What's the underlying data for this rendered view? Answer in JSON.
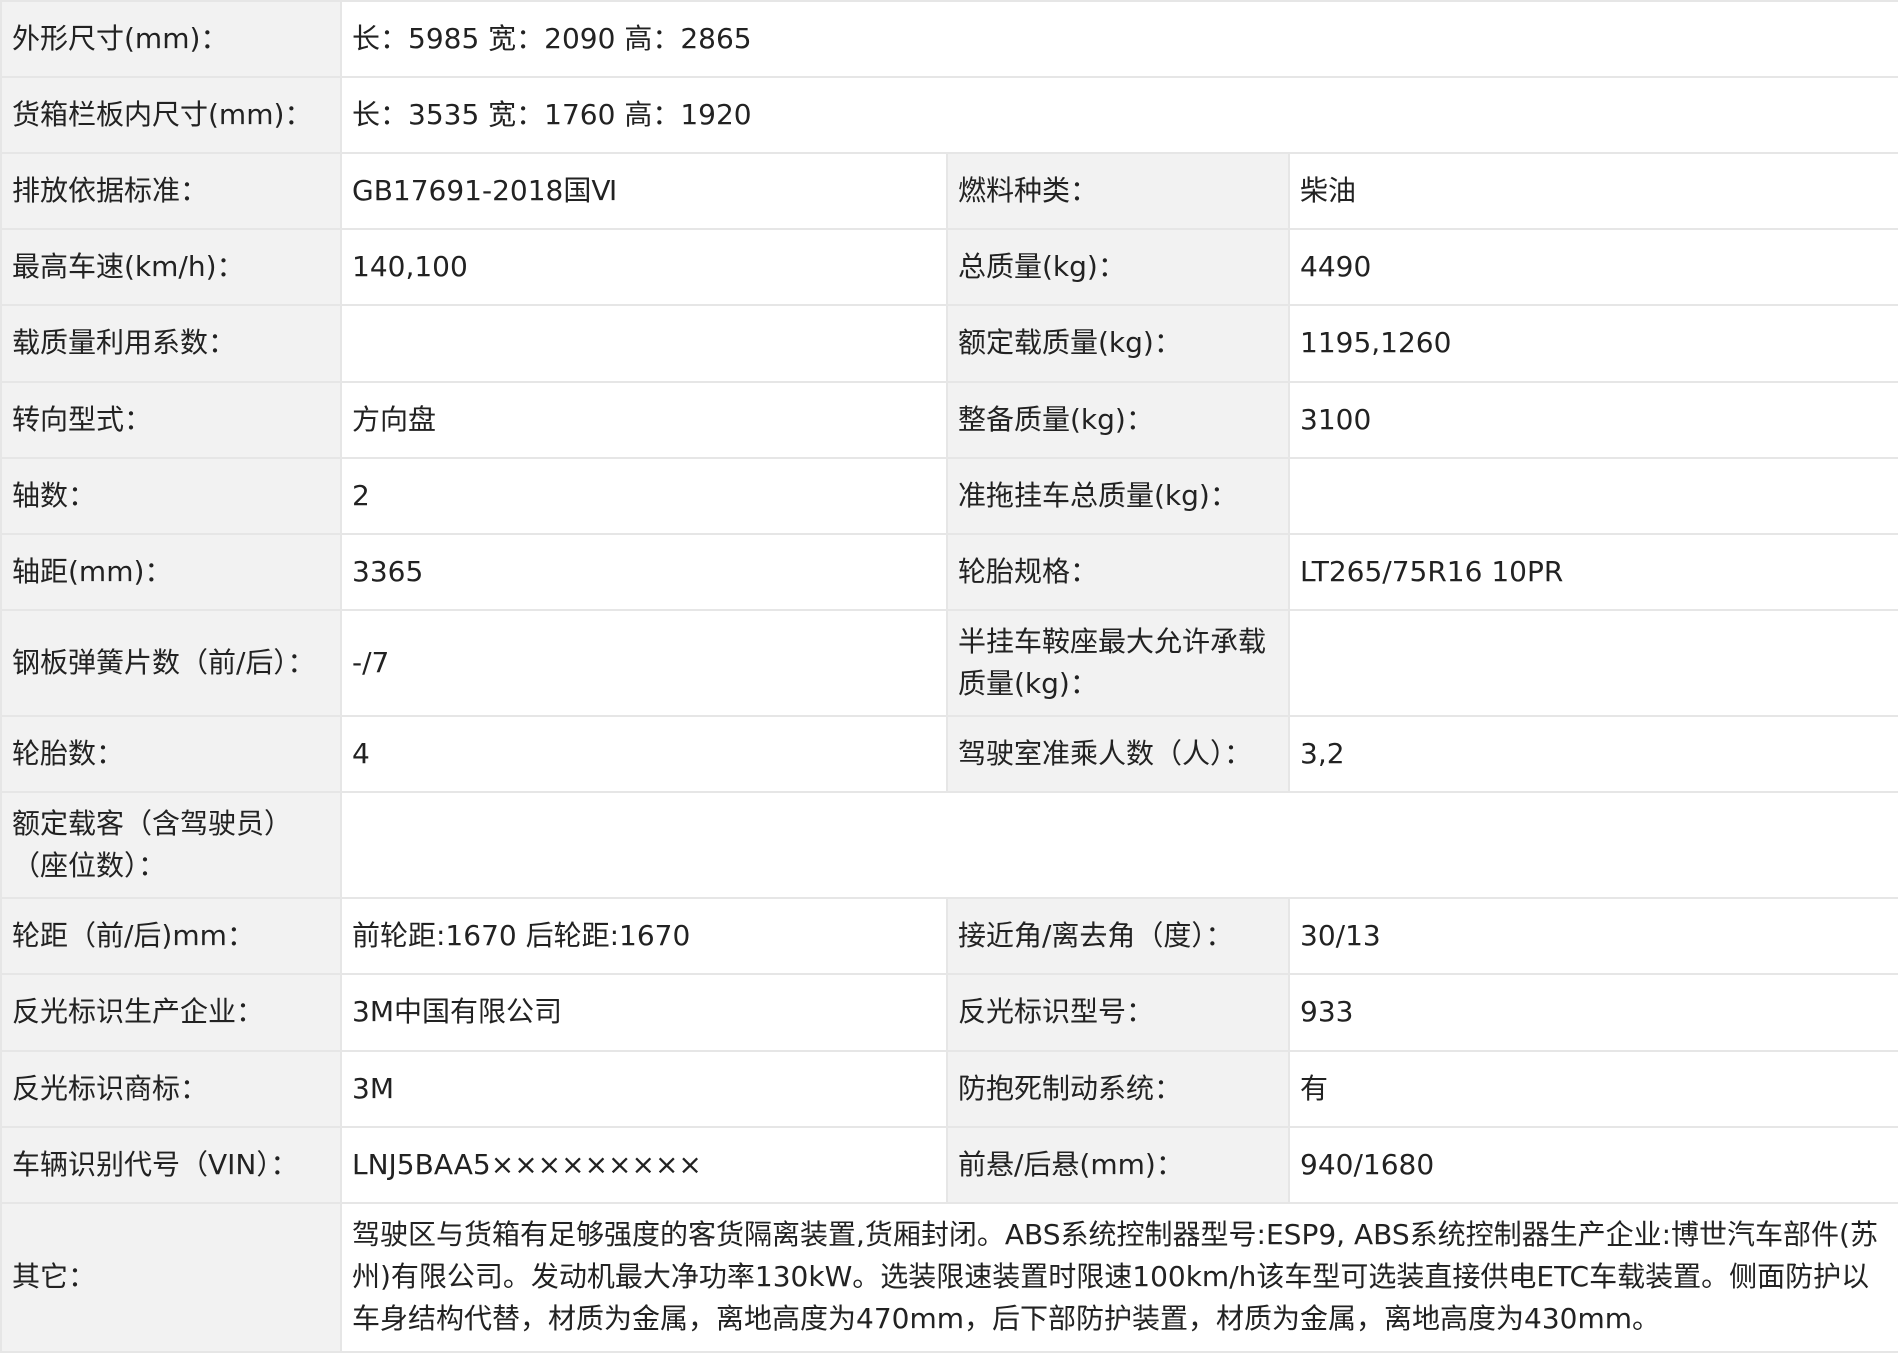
{
  "rows": [
    {
      "l1": "外形尺寸(mm)：",
      "v1": "长：5985 宽：2090 高：2865"
    },
    {
      "l1": "货箱栏板内尺寸(mm)：",
      "v1": "长：3535 宽：1760 高：1920"
    },
    {
      "l1": "排放依据标准：",
      "v1": "GB17691-2018国Ⅵ",
      "l2": "燃料种类：",
      "v2": "柴油"
    },
    {
      "l1": "最高车速(km/h)：",
      "v1": "140,100",
      "l2": "总质量(kg)：",
      "v2": "4490"
    },
    {
      "l1": "载质量利用系数：",
      "v1": "",
      "l2": "额定载质量(kg)：",
      "v2": "1195,1260"
    },
    {
      "l1": "转向型式：",
      "v1": "方向盘",
      "l2": "整备质量(kg)：",
      "v2": "3100"
    },
    {
      "l1": "轴数：",
      "v1": "2",
      "l2": "准拖挂车总质量(kg)：",
      "v2": ""
    },
    {
      "l1": "轴距(mm)：",
      "v1": "3365",
      "l2": "轮胎规格：",
      "v2": "LT265/75R16 10PR"
    },
    {
      "l1": "钢板弹簧片数（前/后）：",
      "v1": "-/7",
      "l2": "半挂车鞍座最大允许承载质量(kg)：",
      "v2": ""
    },
    {
      "l1": "轮胎数：",
      "v1": "4",
      "l2": "驾驶室准乘人数（人）：",
      "v2": "3,2"
    },
    {
      "l1": "额定载客（含驾驶员）（座位数）：",
      "v1": ""
    },
    {
      "l1": "轮距（前/后)mm：",
      "v1": "前轮距:1670 后轮距:1670",
      "l2": "接近角/离去角（度）：",
      "v2": "30/13"
    },
    {
      "l1": "反光标识生产企业：",
      "v1": "3M中国有限公司",
      "l2": "反光标识型号：",
      "v2": "933"
    },
    {
      "l1": "反光标识商标：",
      "v1": "3M",
      "l2": "防抱死制动系统：",
      "v2": "有"
    },
    {
      "l1": "车辆识别代号（VIN）：",
      "v1": "LNJ5BAA5×××××××××",
      "l2": "前悬/后悬(mm)：",
      "v2": "940/1680"
    },
    {
      "l1": "其它：",
      "v1": "驾驶区与货箱有足够强度的客货隔离装置,货厢封闭。ABS系统控制器型号:ESP9, ABS系统控制器生产企业:博世汽车部件(苏州)有限公司。发动机最大净功率130kW。选装限速装置时限速100km/h该车型可选装直接供电ETC车载装置。侧面防护以车身结构代替，材质为金属，离地高度为470mm，后下部防护装置，材质为金属，离地高度为430mm。"
    }
  ]
}
